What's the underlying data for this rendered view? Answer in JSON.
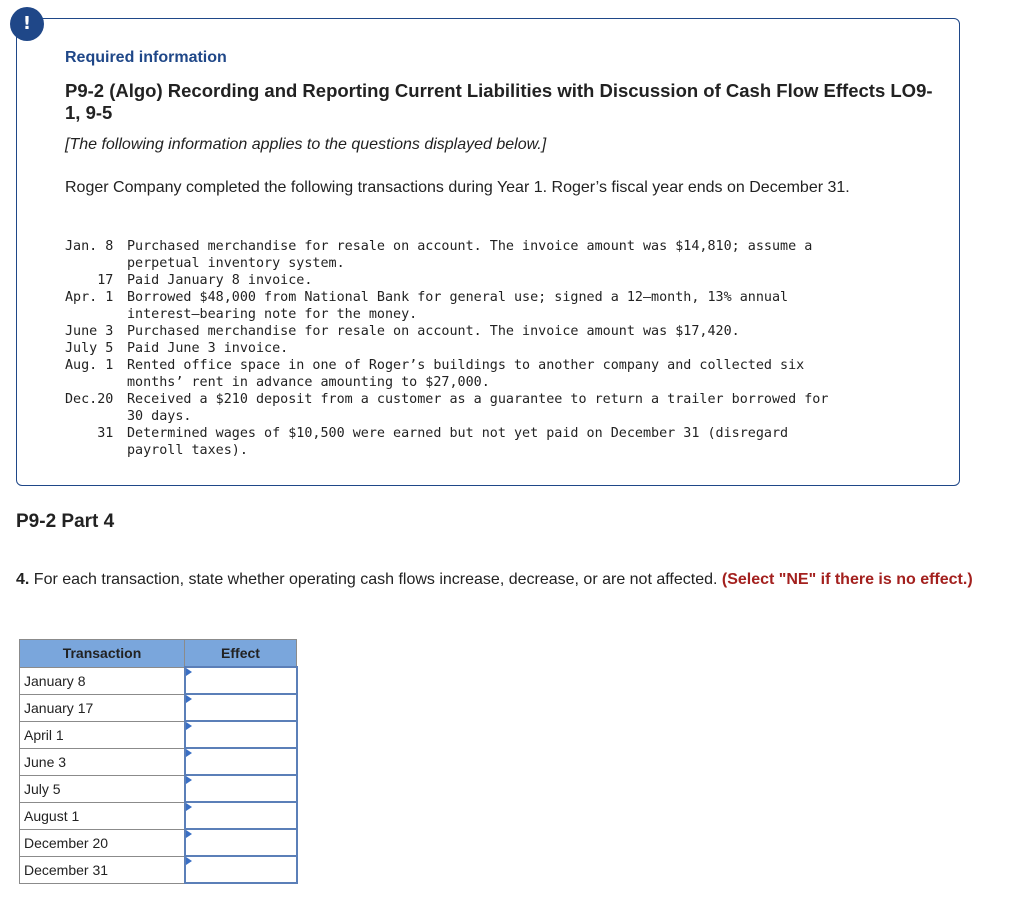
{
  "card": {
    "icon": "!",
    "icon_name": "alert-exclamation-icon",
    "required_label": "Required information",
    "problem_title": "P9-2 (Algo) Recording and Reporting Current Liabilities with Discussion of Cash Flow Effects LO9-1, 9-5",
    "intro_note": "[The following information applies to the questions displayed below.]",
    "scenario": "Roger Company completed the following transactions during Year 1. Roger’s fiscal year ends on December 31.",
    "transactions": [
      {
        "date": "Jan. 8",
        "desc": "Purchased merchandise for resale on account. The invoice amount was $14,810; assume a\nperpetual inventory system."
      },
      {
        "date": "    17",
        "desc": "Paid January 8 invoice."
      },
      {
        "date": "Apr. 1",
        "desc": "Borrowed $48,000 from National Bank for general use; signed a 12–month, 13% annual\ninterest–bearing note for the money."
      },
      {
        "date": "June 3",
        "desc": "Purchased merchandise for resale on account. The invoice amount was $17,420."
      },
      {
        "date": "July 5",
        "desc": "Paid June 3 invoice."
      },
      {
        "date": "Aug. 1",
        "desc": "Rented office space in one of Roger’s buildings to another company and collected six\nmonths’ rent in advance amounting to $27,000."
      },
      {
        "date": "Dec.20",
        "desc": "Received a $210 deposit from a customer as a guarantee to return a trailer borrowed for\n30 days."
      },
      {
        "date": "    31",
        "desc": "Determined wages of $10,500 were earned but not yet paid on December 31 (disregard\npayroll taxes)."
      }
    ]
  },
  "part": {
    "heading": "P9-2 Part 4",
    "question_number": "4.",
    "question_text": " For each transaction, state whether operating cash flows increase, decrease, or are not affected. ",
    "question_hint": "(Select \"NE\" if there is no effect.)"
  },
  "table": {
    "headers": {
      "transaction": "Transaction",
      "effect": "Effect"
    },
    "rows": [
      {
        "transaction": "January 8",
        "effect": ""
      },
      {
        "transaction": "January 17",
        "effect": ""
      },
      {
        "transaction": "April 1",
        "effect": ""
      },
      {
        "transaction": "June 3",
        "effect": ""
      },
      {
        "transaction": "July 5",
        "effect": ""
      },
      {
        "transaction": "August 1",
        "effect": ""
      },
      {
        "transaction": "December 20",
        "effect": ""
      },
      {
        "transaction": "December 31",
        "effect": ""
      }
    ]
  },
  "colors": {
    "brand_blue": "#1f4788",
    "hint_red": "#a3201e",
    "table_header": "#7aa6dc",
    "select_border": "#5b7fb8"
  }
}
